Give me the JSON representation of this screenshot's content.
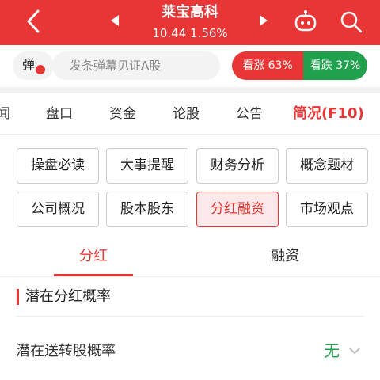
{
  "header": {
    "title": "莱宝高科",
    "subtitle": "10.44  1.56%",
    "bg_color": "#e83535",
    "icons": [
      "back-icon",
      "prev-arrow-icon",
      "next-arrow-icon",
      "robot-icon",
      "search-icon"
    ]
  },
  "danmu": {
    "toggle_label": "弹",
    "placeholder": "发条弹幕见证A股",
    "up_label": "看涨 63%",
    "down_label": "看跌 37%",
    "up_color": "#e83535",
    "down_color": "#21a14e"
  },
  "tabs": [
    "闻",
    "盘口",
    "资金",
    "论股",
    "公告",
    "简况(F10)"
  ],
  "active_tab": "简况(F10)",
  "grid": [
    [
      "操盘必读",
      "大事提醒",
      "财务分析",
      "概念题材"
    ],
    [
      "公司概况",
      "股本股东",
      "分红融资",
      "市场观点"
    ]
  ],
  "active_grid_item": "分红融资",
  "subtabs": [
    "分红",
    "融资"
  ],
  "active_subtab": "分红",
  "section": {
    "title": "潜在分红概率",
    "row_label": "潜在送转股概率",
    "row_value": "无"
  }
}
